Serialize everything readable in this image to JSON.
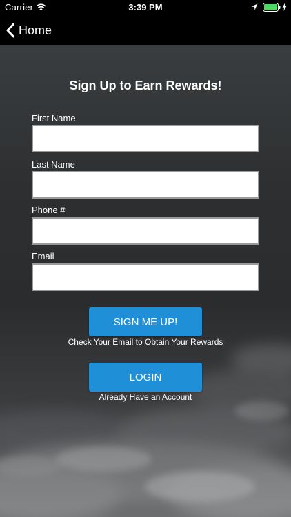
{
  "status_bar": {
    "carrier": "Carrier",
    "time": "3:39 PM",
    "battery_color": "#4cd964"
  },
  "nav": {
    "back_label": "Home"
  },
  "form": {
    "title": "Sign Up to Earn Rewards!",
    "fields": [
      {
        "label": "First Name",
        "value": "",
        "placeholder": ""
      },
      {
        "label": "Last Name",
        "value": "",
        "placeholder": ""
      },
      {
        "label": "Phone #",
        "value": "",
        "placeholder": ""
      },
      {
        "label": "Email",
        "value": "",
        "placeholder": ""
      }
    ],
    "signup_button": "SIGN ME UP!",
    "signup_caption": "Check Your Email to Obtain Your Rewards",
    "login_button": "LOGIN",
    "login_caption": "Already Have an Account"
  },
  "colors": {
    "button_blue": "#1f8fd8",
    "nav_background": "#000000"
  }
}
